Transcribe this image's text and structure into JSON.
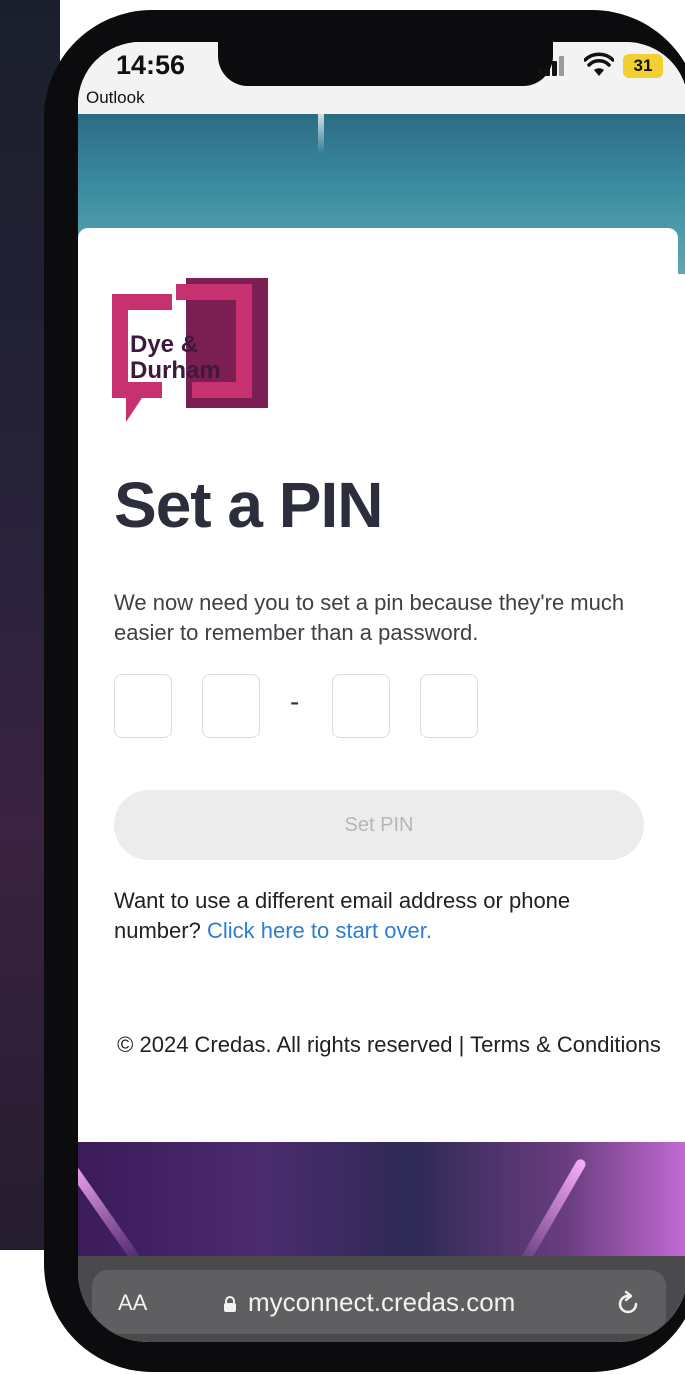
{
  "status_bar": {
    "time": "14:56",
    "back_app": "Outlook",
    "battery": "31"
  },
  "brand": {
    "logo_line1": "Dye &",
    "logo_line2": "Durham",
    "primary_color": "#c7316f",
    "dark_color": "#7b1f52"
  },
  "page": {
    "title": "Set a PIN",
    "description": "We now need you to set a pin because they're much easier to remember than a password.",
    "pin_separator": "-",
    "set_pin_label": "Set PIN",
    "start_over_text": "Want to use a different email address or phone number? ",
    "start_over_link": "Click here to start over.",
    "footer": "© 2024 Credas. All rights reserved | Terms & Conditions"
  },
  "browser": {
    "aa_label": "AA",
    "url": "myconnect.credas.com"
  }
}
